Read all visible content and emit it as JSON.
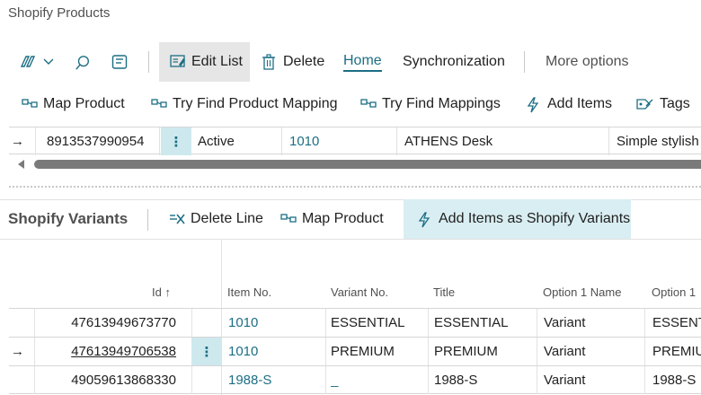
{
  "page": {
    "title": "Shopify Products"
  },
  "actionbar": {
    "edit_list": "Edit List",
    "delete": "Delete",
    "home": "Home",
    "synchronization": "Synchronization",
    "more_options": "More options"
  },
  "toolbar": {
    "map_product": "Map Product",
    "try_find_product_mapping": "Try Find Product Mapping",
    "try_find_mappings": "Try Find Mappings",
    "add_items": "Add Items",
    "tags": "Tags"
  },
  "product_row": {
    "arrow": "→",
    "id": "8913537990954",
    "status": "Active",
    "item_no": "1010",
    "description": "ATHENS Desk",
    "body": "Simple stylish"
  },
  "variants": {
    "title": "Shopify Variants",
    "toolbar": {
      "delete_line": "Delete Line",
      "map_product": "Map Product",
      "add_items_as_variants": "Add Items as Shopify Variants"
    },
    "columns": {
      "id": "Id ↑",
      "item_no": "Item No.",
      "variant_no": "Variant No.",
      "title": "Title",
      "option1_name": "Option 1 Name",
      "option1_value": "Option 1"
    },
    "rows": [
      {
        "arrow": "",
        "id": "47613949673770",
        "item_no": "1010",
        "variant_no": "ESSENTIAL",
        "title": "ESSENTIAL",
        "option1_name": "Variant",
        "option1_value": "ESSENTIAL"
      },
      {
        "arrow": "→",
        "id": "47613949706538",
        "item_no": "1010",
        "variant_no": "PREMIUM",
        "title": "PREMIUM",
        "option1_name": "Variant",
        "option1_value": "PREMIUM"
      },
      {
        "arrow": "",
        "id": "49059613868330",
        "item_no": "1988-S",
        "variant_no": "_",
        "title": "1988-S",
        "option1_name": "Variant",
        "option1_value": "1988-S"
      }
    ]
  },
  "colors": {
    "accent": "#1c6e84",
    "selected_bg": "#cde9ee",
    "hover_bg": "#e6e6e6"
  }
}
